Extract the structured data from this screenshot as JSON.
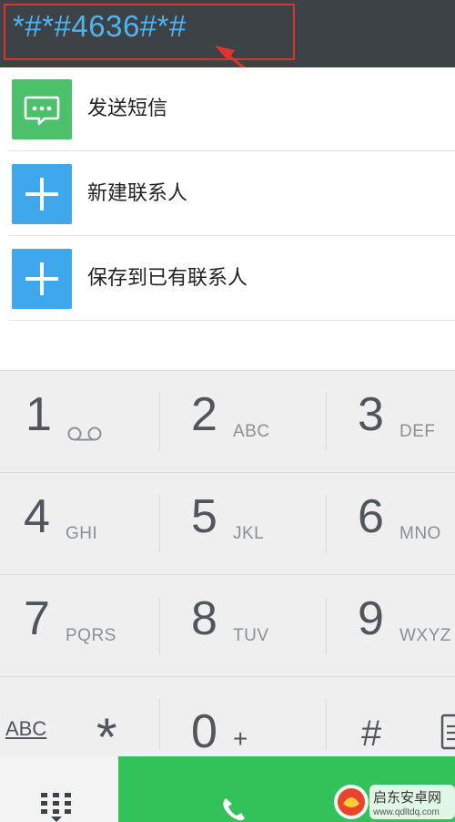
{
  "dialer": {
    "number": "*#*#4636#*#"
  },
  "actions": [
    {
      "label": "发送短信",
      "icon": "message-icon",
      "color": "#4cc06b"
    },
    {
      "label": "新建联系人",
      "icon": "plus-icon",
      "color": "#3fa7ec"
    },
    {
      "label": "保存到已有联系人",
      "icon": "plus-icon",
      "color": "#3fa7ec"
    }
  ],
  "keypad": {
    "keys": [
      {
        "digit": "1",
        "letters": "",
        "icon": "voicemail-icon"
      },
      {
        "digit": "2",
        "letters": "ABC"
      },
      {
        "digit": "3",
        "letters": "DEF"
      },
      {
        "digit": "4",
        "letters": "GHI"
      },
      {
        "digit": "5",
        "letters": "JKL"
      },
      {
        "digit": "6",
        "letters": "MNO"
      },
      {
        "digit": "7",
        "letters": "PQRS"
      },
      {
        "digit": "8",
        "letters": "TUV"
      },
      {
        "digit": "9",
        "letters": "WXYZ"
      }
    ],
    "bottom_row": {
      "abc_label": "ABC",
      "star": "*",
      "zero": "0",
      "plus": "+",
      "hash": "#"
    }
  },
  "watermark": {
    "brand": "启东安卓网",
    "url": "www.qdltdq.com"
  },
  "colors": {
    "top_bar": "#3d4247",
    "number_text": "#4fb3f0",
    "highlight_box": "#d9342b",
    "call_green": "#33c25a",
    "sms_green": "#4cc06b",
    "contact_blue": "#3fa7ec"
  }
}
